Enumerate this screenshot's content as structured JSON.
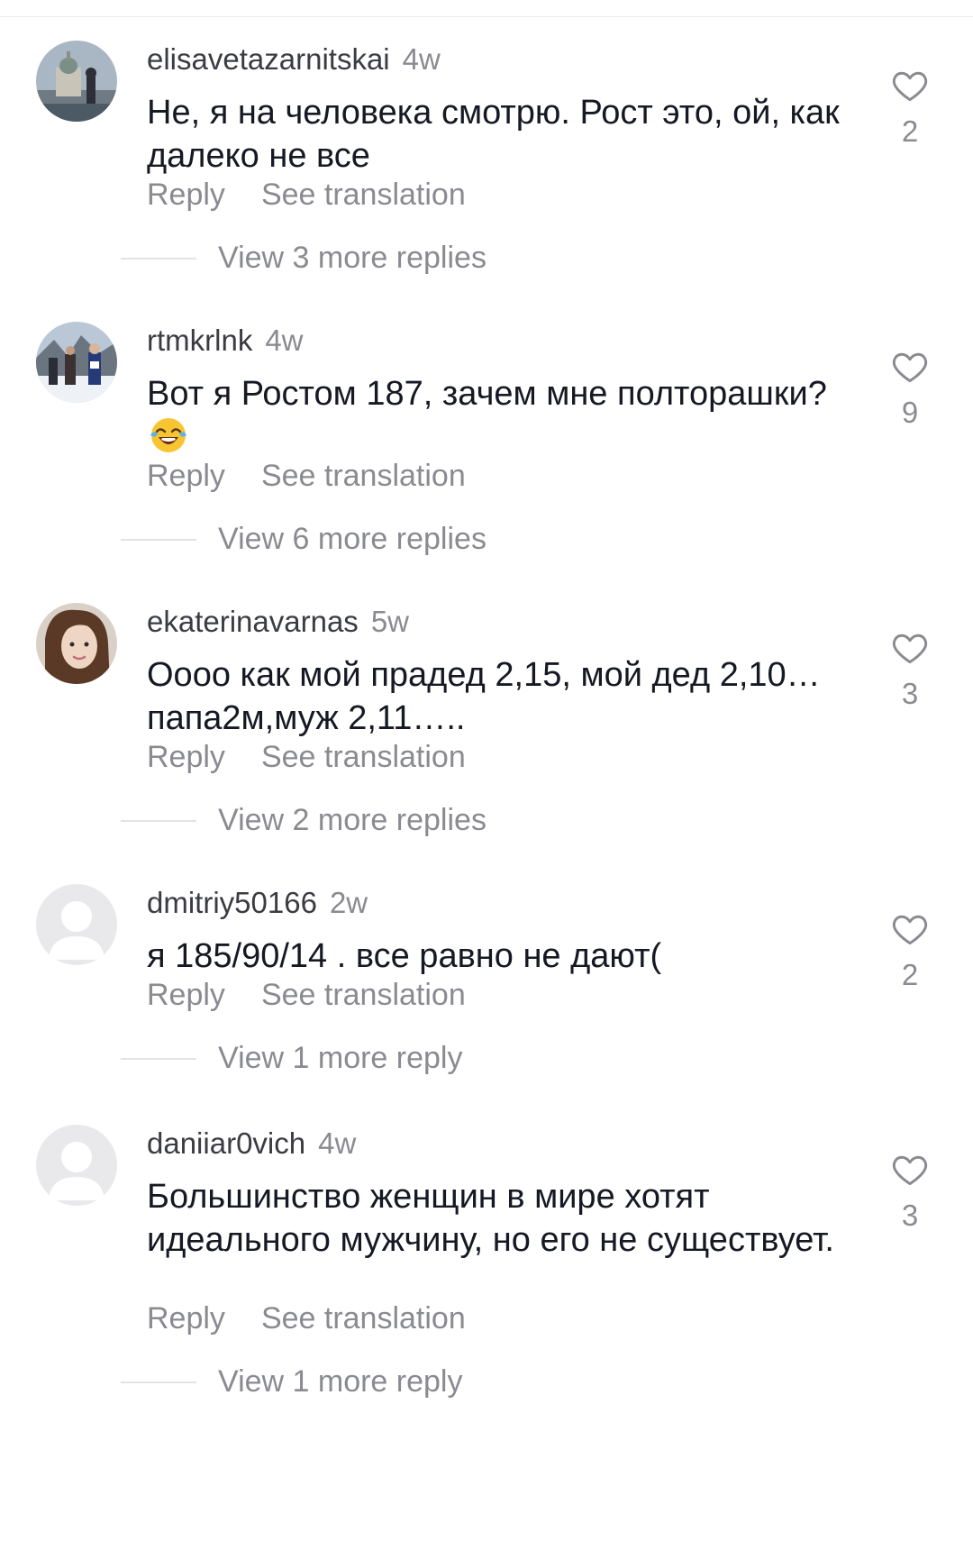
{
  "comments": [
    {
      "username": "elisavetazarnitskai",
      "time": "4w",
      "text": "Не, я на человека смотрю. Рост это, ой, как далеко не все",
      "likes": "2",
      "reply_label": "Reply",
      "translate_label": "See translation",
      "view_replies": "View 3 more replies",
      "avatar": "photo-building"
    },
    {
      "username": "rtmkrlnk",
      "time": "4w",
      "text": "Вот я  Ростом 187, зачем мне полторашки?",
      "emoji": "😂",
      "likes": "9",
      "reply_label": "Reply",
      "translate_label": "See translation",
      "view_replies": "View 6 more replies",
      "avatar": "photo-winter-crowd"
    },
    {
      "username": "ekaterinavarnas",
      "time": "5w",
      "text": "Оооо как мой прадед 2,15, мой дед 2,10…папа2м,муж 2,11…..",
      "likes": "3",
      "reply_label": "Reply",
      "translate_label": "See translation",
      "view_replies": "View 2 more replies",
      "avatar": "photo-portrait"
    },
    {
      "username": "dmitriy50166",
      "time": "2w",
      "text": "я 185/90/14 . все равно не дают(",
      "likes": "2",
      "reply_label": "Reply",
      "translate_label": "See translation",
      "view_replies": "View 1 more reply",
      "avatar": "default-avatar"
    },
    {
      "username": "daniiar0vich",
      "time": "4w",
      "text": "Большинство женщин в мире хотят идеального мужчину, но его не существует.",
      "likes": "3",
      "reply_label": "Reply",
      "translate_label": "See translation",
      "view_replies": "View 1 more reply",
      "avatar": "default-avatar"
    }
  ],
  "icons": {
    "like": "heart-outline-icon",
    "emoji": "face-with-tears-of-joy"
  },
  "colors": {
    "text_primary": "#161823",
    "text_secondary": "#8a8b91",
    "username": "#3b3c43",
    "default_avatar_bg": "#e9e9eb"
  }
}
